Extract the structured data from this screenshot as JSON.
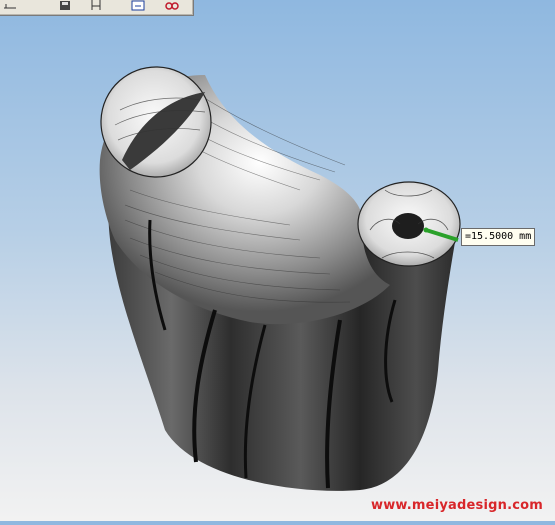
{
  "toolbar": {
    "buttons": [
      {
        "icon": "ruler-icon"
      },
      {
        "icon": "save-icon"
      },
      {
        "icon": "measure-icon"
      },
      {
        "icon": "view-icon"
      },
      {
        "icon": "glasses-icon"
      }
    ],
    "accent_color": "#c0182a"
  },
  "viewport": {
    "model": "shaded 3D vessel part with isocline lines",
    "measurement": {
      "label": "=15.5000 mm",
      "color": "#2aa12a"
    }
  },
  "watermark": {
    "text": "www.meiyadesign.com",
    "color": "#d8262a"
  }
}
